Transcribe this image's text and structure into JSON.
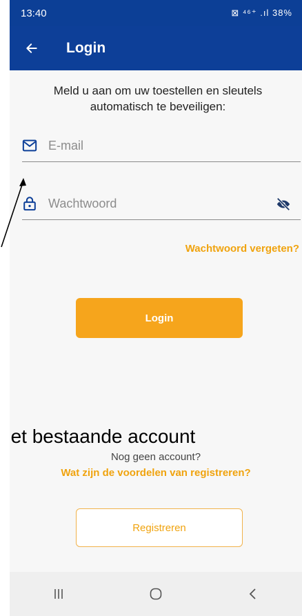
{
  "status_bar": {
    "time": "13:40",
    "icons": "⊠ ⁴⁶⁺ .ıl 38%"
  },
  "app_bar": {
    "title": "Login"
  },
  "intro": {
    "text": "Meld u aan om uw toestellen en sleutels automatisch te beveiligen:"
  },
  "email": {
    "placeholder": "E-mail",
    "value": ""
  },
  "password": {
    "placeholder": "Wachtwoord",
    "value": ""
  },
  "forgot_password": "Wachtwoord vergeten?",
  "login_button": "Login",
  "annotation_text": "het bestaande account",
  "no_account": "Nog geen account?",
  "benefits_link": "Wat zijn de voordelen van registreren?",
  "register_button": "Registreren",
  "colors": {
    "primary_blue": "#0d3f98",
    "accent_orange": "#f6a51c",
    "link_orange": "#f0a30e"
  },
  "icons": {
    "back": "arrow-left-icon",
    "email": "mail-icon",
    "password": "lock-icon",
    "visibility": "eye-off-icon",
    "nav_recent": "recent-apps-icon",
    "nav_home": "home-icon",
    "nav_back": "back-chevron-icon"
  }
}
